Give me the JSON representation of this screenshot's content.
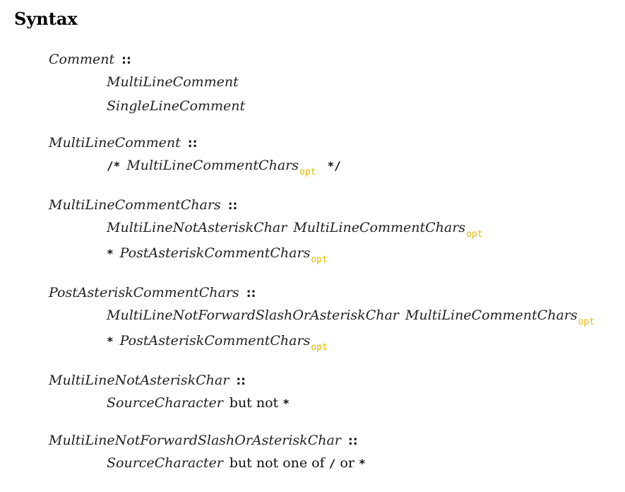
{
  "heading": "Syntax",
  "geq": "::",
  "opt": "opt",
  "p1": {
    "lhs": "Comment",
    "r1": "MultiLineComment",
    "r2": "SingleLineComment"
  },
  "p2": {
    "lhs": "MultiLineComment",
    "r1_open": "/*",
    "r1_nt": "MultiLineCommentChars",
    "r1_close": "*/"
  },
  "p3": {
    "lhs": "MultiLineCommentChars",
    "r1_nt1": "MultiLineNotAsteriskChar",
    "r1_nt2": "MultiLineCommentChars",
    "r2_star": "*",
    "r2_nt": "PostAsteriskCommentChars"
  },
  "p4": {
    "lhs": "PostAsteriskCommentChars",
    "r1_nt1": "MultiLineNotForwardSlashOrAsteriskChar",
    "r1_nt2": "MultiLineCommentChars",
    "r2_star": "*",
    "r2_nt": "PostAsteriskCommentChars"
  },
  "p5": {
    "lhs": "MultiLineNotAsteriskChar",
    "r1_nt": "SourceCharacter",
    "r1_text": "but not",
    "r1_star": "*"
  },
  "p6": {
    "lhs": "MultiLineNotForwardSlashOrAsteriskChar",
    "r1_nt": "SourceCharacter",
    "r1_text": "but not one of",
    "r1_slash": "/",
    "r1_or": "or",
    "r1_star": "*"
  }
}
